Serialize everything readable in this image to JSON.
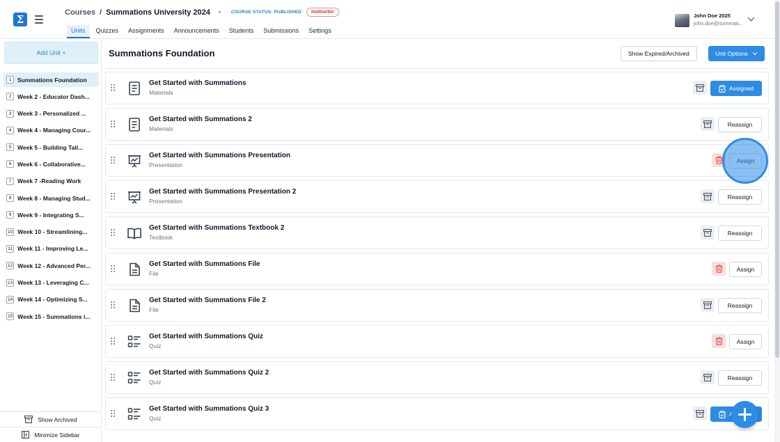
{
  "app": {
    "logo_glyph": "Σ"
  },
  "breadcrumb": {
    "root": "Courses",
    "separator": "/",
    "course": "Summations University 2024"
  },
  "course_status": "COURSE STATUS: PUBLISHED",
  "role_badge": "Instructor",
  "tabs": [
    {
      "label": "Units",
      "active": true
    },
    {
      "label": "Quizzes"
    },
    {
      "label": "Assignments"
    },
    {
      "label": "Announcements"
    },
    {
      "label": "Students"
    },
    {
      "label": "Submissions"
    },
    {
      "label": "Settings"
    }
  ],
  "user": {
    "name": "John Doe 2025",
    "email": "john.doe@summati..."
  },
  "sidebar": {
    "add_unit_label": "Add Unit +",
    "units": [
      {
        "num": "1",
        "name": "Summations Foundation",
        "active": true
      },
      {
        "num": "2",
        "name": "Week 2 - Educator Dash..."
      },
      {
        "num": "3",
        "name": "Week 3 - Personalized ..."
      },
      {
        "num": "4",
        "name": "Week 4 - Managing Cour..."
      },
      {
        "num": "5",
        "name": "Week 5 - Building Tail..."
      },
      {
        "num": "6",
        "name": "Week 6 - Collaborative..."
      },
      {
        "num": "7",
        "name": "Week 7 -Reading Work"
      },
      {
        "num": "8",
        "name": "Week 8 - Managing Stud..."
      },
      {
        "num": "9",
        "name": "Week 9 - Integrating S..."
      },
      {
        "num": "10",
        "name": "Week 10 - Streamlining..."
      },
      {
        "num": "11",
        "name": "Week 11 - Improving Le..."
      },
      {
        "num": "12",
        "name": "Week 12 - Advanced Per..."
      },
      {
        "num": "13",
        "name": "Week 13 - Leveraging C..."
      },
      {
        "num": "14",
        "name": "Week 14 - Optimizing S..."
      },
      {
        "num": "15",
        "name": "Week 15 - Summations i..."
      }
    ],
    "show_archived_label": "Show Archived",
    "minimize_label": "Minimize Sidebar"
  },
  "main": {
    "title": "Summations Foundation",
    "show_expired_label": "Show Expired/Archived",
    "unit_options_label": "Unit Options"
  },
  "materials": [
    {
      "title": "Get Started with Summations",
      "type": "Materials",
      "icon": "document-icon",
      "action": "Assigned",
      "side": "archive"
    },
    {
      "title": "Get Started with Summations 2",
      "type": "Materials",
      "icon": "document-icon",
      "action": "Reassign",
      "side": "archive"
    },
    {
      "title": "Get Started with Summations Presentation",
      "type": "Presentation",
      "icon": "presentation-icon",
      "action": "Assign",
      "side": "delete"
    },
    {
      "title": "Get Started with Summations Presentation 2",
      "type": "Presentation",
      "icon": "presentation-icon",
      "action": "Reassign",
      "side": "archive"
    },
    {
      "title": "Get Started with Summations Textbook 2",
      "type": "Textbook",
      "icon": "book-icon",
      "action": "Reassign",
      "side": "archive"
    },
    {
      "title": "Get Started with Summations File",
      "type": "File",
      "icon": "file-icon",
      "action": "Assign",
      "side": "delete"
    },
    {
      "title": "Get Started with Summations File 2",
      "type": "File",
      "icon": "file-icon",
      "action": "Reassign",
      "side": "archive"
    },
    {
      "title": "Get Started with Summations Quiz",
      "type": "Quiz",
      "icon": "quiz-icon",
      "action": "Assign",
      "side": "delete"
    },
    {
      "title": "Get Started with Summations Quiz 2",
      "type": "Quiz",
      "icon": "quiz-icon",
      "action": "Reassign",
      "side": "archive"
    },
    {
      "title": "Get Started with Summations Quiz 3",
      "type": "Quiz",
      "icon": "quiz-icon",
      "action": "Assigned",
      "side": "archive"
    }
  ],
  "colors": {
    "primary": "#2e8be6",
    "danger": "#e05252",
    "active_bg": "#dff0fb"
  }
}
